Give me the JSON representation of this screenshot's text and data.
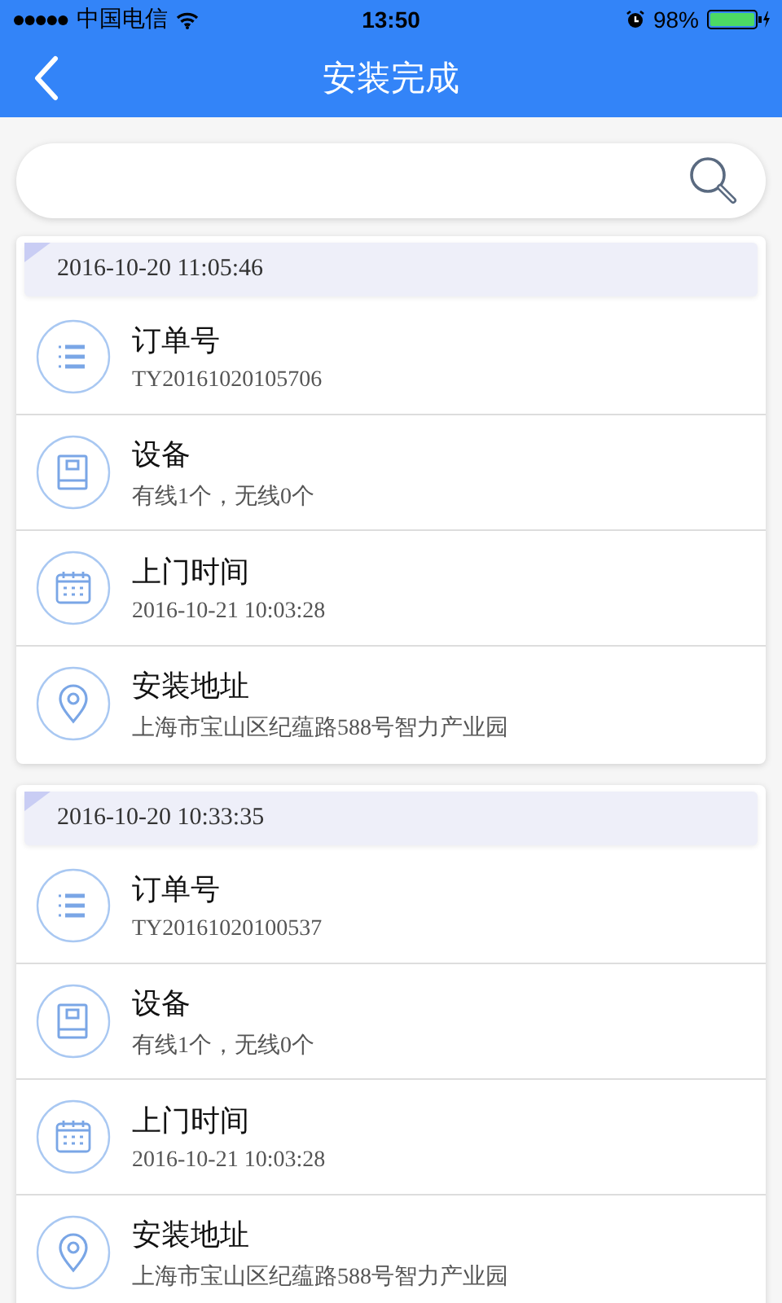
{
  "status_bar": {
    "carrier": "中国电信",
    "time": "13:50",
    "battery": "98%"
  },
  "nav": {
    "title": "安装完成"
  },
  "orders": [
    {
      "timestamp": "2016-10-20 11:05:46",
      "rows": [
        {
          "kind": "order",
          "label": "订单号",
          "value": "TY20161020105706"
        },
        {
          "kind": "device",
          "label": "设备",
          "value": "有线1个，无线0个"
        },
        {
          "kind": "time",
          "label": "上门时间",
          "value": "2016-10-21 10:03:28"
        },
        {
          "kind": "address",
          "label": "安装地址",
          "value": "上海市宝山区纪蕴路588号智力产业园"
        }
      ]
    },
    {
      "timestamp": "2016-10-20 10:33:35",
      "rows": [
        {
          "kind": "order",
          "label": "订单号",
          "value": "TY20161020100537"
        },
        {
          "kind": "device",
          "label": "设备",
          "value": "有线1个，无线0个"
        },
        {
          "kind": "time",
          "label": "上门时间",
          "value": "2016-10-21 10:03:28"
        },
        {
          "kind": "address",
          "label": "安装地址",
          "value": "上海市宝山区纪蕴路588号智力产业园"
        }
      ]
    }
  ]
}
